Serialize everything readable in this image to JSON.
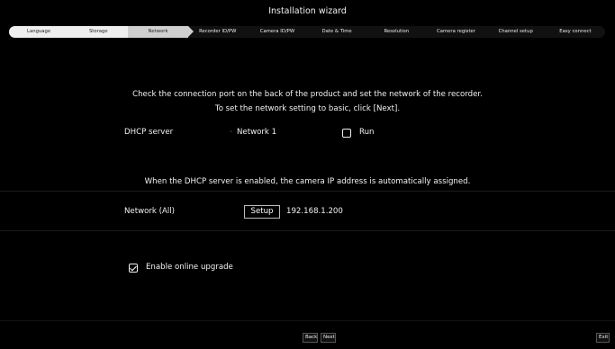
{
  "window": {
    "title": "Installation wizard"
  },
  "steps": [
    {
      "label": "Language",
      "state": "done"
    },
    {
      "label": "Storage",
      "state": "done"
    },
    {
      "label": "Network",
      "state": "current"
    },
    {
      "label": "Recorder ID/PW",
      "state": "todo"
    },
    {
      "label": "Camera ID/PW",
      "state": "todo"
    },
    {
      "label": "Date & Time",
      "state": "todo"
    },
    {
      "label": "Resolution",
      "state": "todo"
    },
    {
      "label": "Camera register",
      "state": "todo"
    },
    {
      "label": "Channel setup",
      "state": "todo"
    },
    {
      "label": "Easy connect",
      "state": "todo"
    }
  ],
  "main": {
    "instruction_line1": "Check the connection port on the back of the product and set the network of the recorder.",
    "instruction_line2": "To set the network setting to basic, click [Next].",
    "dhcp": {
      "label": "DHCP server",
      "bullet": "·",
      "network": "Network 1",
      "run_label": "Run",
      "run_checked": false
    },
    "dhcp_note": "When the DHCP server is enabled, the camera IP address is automatically assigned.",
    "network_all": {
      "label": "Network (All)",
      "setup_label": "Setup",
      "ip": "192.168.1.200"
    },
    "online_upgrade": {
      "label": "Enable online upgrade",
      "checked": true
    }
  },
  "footer": {
    "back_label": "Back",
    "next_label": "Next",
    "exit_label": "Exit"
  },
  "colors": {
    "background": "#000000",
    "step_done": "#efefef",
    "step_current": "#cfcfcf",
    "text": "#f2f2f2"
  }
}
